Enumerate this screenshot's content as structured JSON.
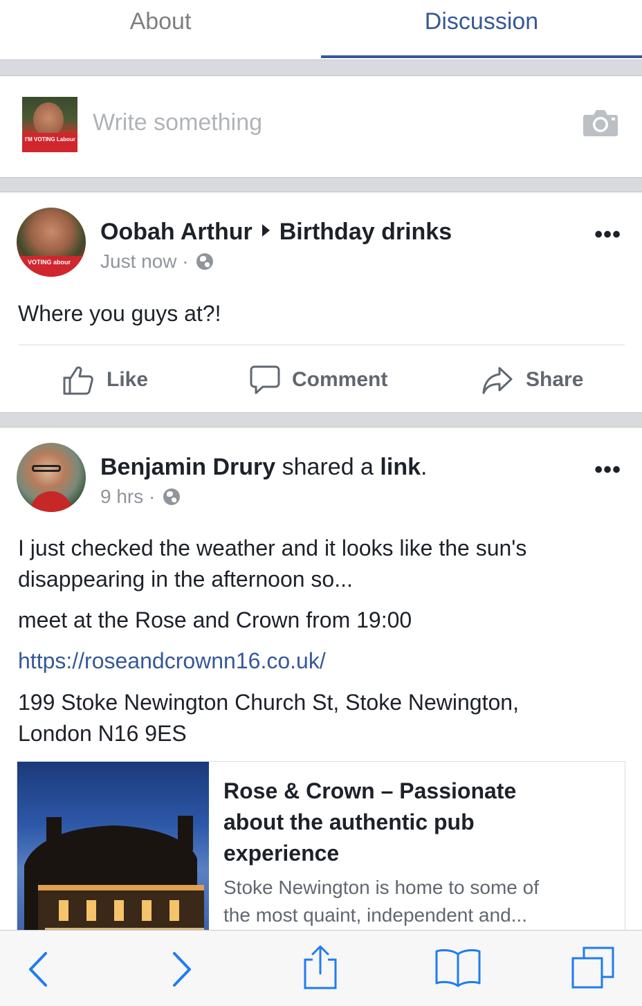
{
  "tabs": [
    {
      "label": "About",
      "active": false
    },
    {
      "label": "Discussion",
      "active": true
    }
  ],
  "composer": {
    "placeholder": "Write something",
    "avatar_badge": "I'M VOTING Labour"
  },
  "posts": [
    {
      "author": "Oobah Arthur",
      "target": "Birthday drinks",
      "time": "Just now",
      "avatar_badge": "VOTING abour",
      "body": "Where you guys at?!",
      "actions": {
        "like": "Like",
        "comment": "Comment",
        "share": "Share"
      }
    },
    {
      "author": "Benjamin Drury",
      "verb": "shared a",
      "object": "link",
      "period": ".",
      "time": "9 hrs",
      "body_lines": [
        "I just checked the weather and it looks like the sun's",
        "disappearing in the afternoon so...",
        "meet at the Rose and Crown from 19:00",
        "https://roseandcrownn16.co.uk/",
        "199 Stoke Newington Church St, Stoke Newington,",
        "London N16 9ES"
      ],
      "link_card": {
        "title_lines": [
          "Rose & Crown – Passionate",
          "about the authentic pub",
          "experience"
        ],
        "desc_lines": [
          "Stoke Newington is home to some of",
          "the most quaint, independent and..."
        ]
      }
    }
  ],
  "meta_separator": "·",
  "more_label": "•••",
  "icons": [
    "camera-icon",
    "globe-icon",
    "like-icon",
    "comment-icon",
    "share-icon",
    "back-icon",
    "forward-icon",
    "share-sheet-icon",
    "bookmarks-icon",
    "tabs-icon"
  ],
  "colors": {
    "accent": "#365899",
    "text": "#1d2129",
    "muted": "#90949c",
    "separator": "#d9dadd",
    "ios_blue": "#1e7cf2"
  }
}
